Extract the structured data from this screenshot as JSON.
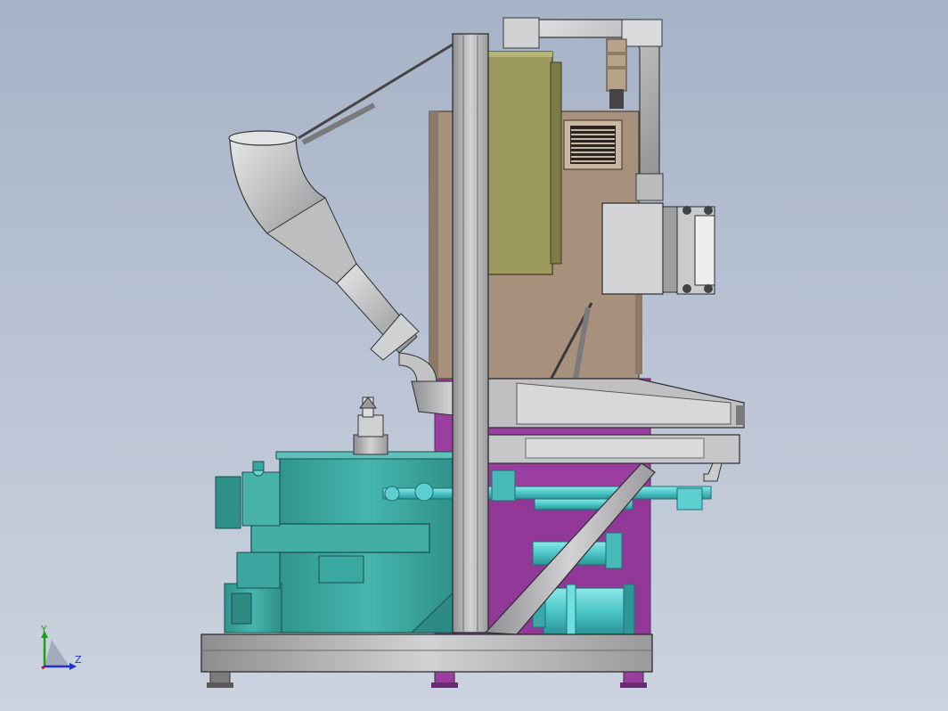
{
  "viewport": {
    "view_label": "",
    "colors": {
      "background_top": "#a6b2c6",
      "background_bottom": "#cbd3df",
      "frame_steel": "#b4b4b6",
      "olive_panel": "#9c9a5c",
      "tan_cabinet": "#a8917c",
      "teal_tank": "#3aa7a0",
      "purple_panel": "#9a3ea0",
      "cyan_pipe": "#5ecfd0",
      "silver_duct": "#c4c6c8"
    }
  },
  "triad": {
    "y_label": "Y",
    "z_label": "Z",
    "icon": "coordinate-triad-icon"
  }
}
